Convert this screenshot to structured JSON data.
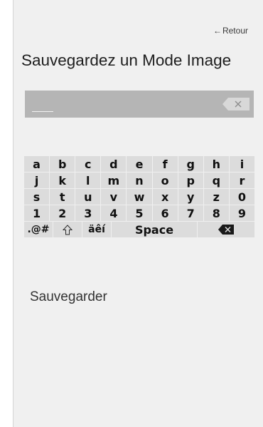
{
  "header": {
    "back_label": "Retour",
    "title": "Sauvegardez un Mode Image"
  },
  "input": {
    "value": "",
    "clear_icon": "clear-x-icon"
  },
  "keyboard": {
    "rows": [
      [
        "a",
        "b",
        "c",
        "d",
        "e",
        "f",
        "g",
        "h",
        "i"
      ],
      [
        "j",
        "k",
        "l",
        "m",
        "n",
        "o",
        "p",
        "q",
        "r"
      ],
      [
        "s",
        "t",
        "u",
        "v",
        "w",
        "x",
        "y",
        "z",
        "0"
      ],
      [
        "1",
        "2",
        "3",
        "4",
        "5",
        "6",
        "7",
        "8",
        "9"
      ]
    ],
    "special": {
      "symbols": ".@#",
      "shift_icon": "shift-arrow-icon",
      "accents": "äêí",
      "space": "Space",
      "backspace_icon": "backspace-icon"
    }
  },
  "actions": {
    "save_label": "Sauvegarder"
  },
  "colors": {
    "screen_bg": "#f0f0f0",
    "input_bg": "#b5b5b5",
    "key_bg": "#dcdcdc"
  }
}
